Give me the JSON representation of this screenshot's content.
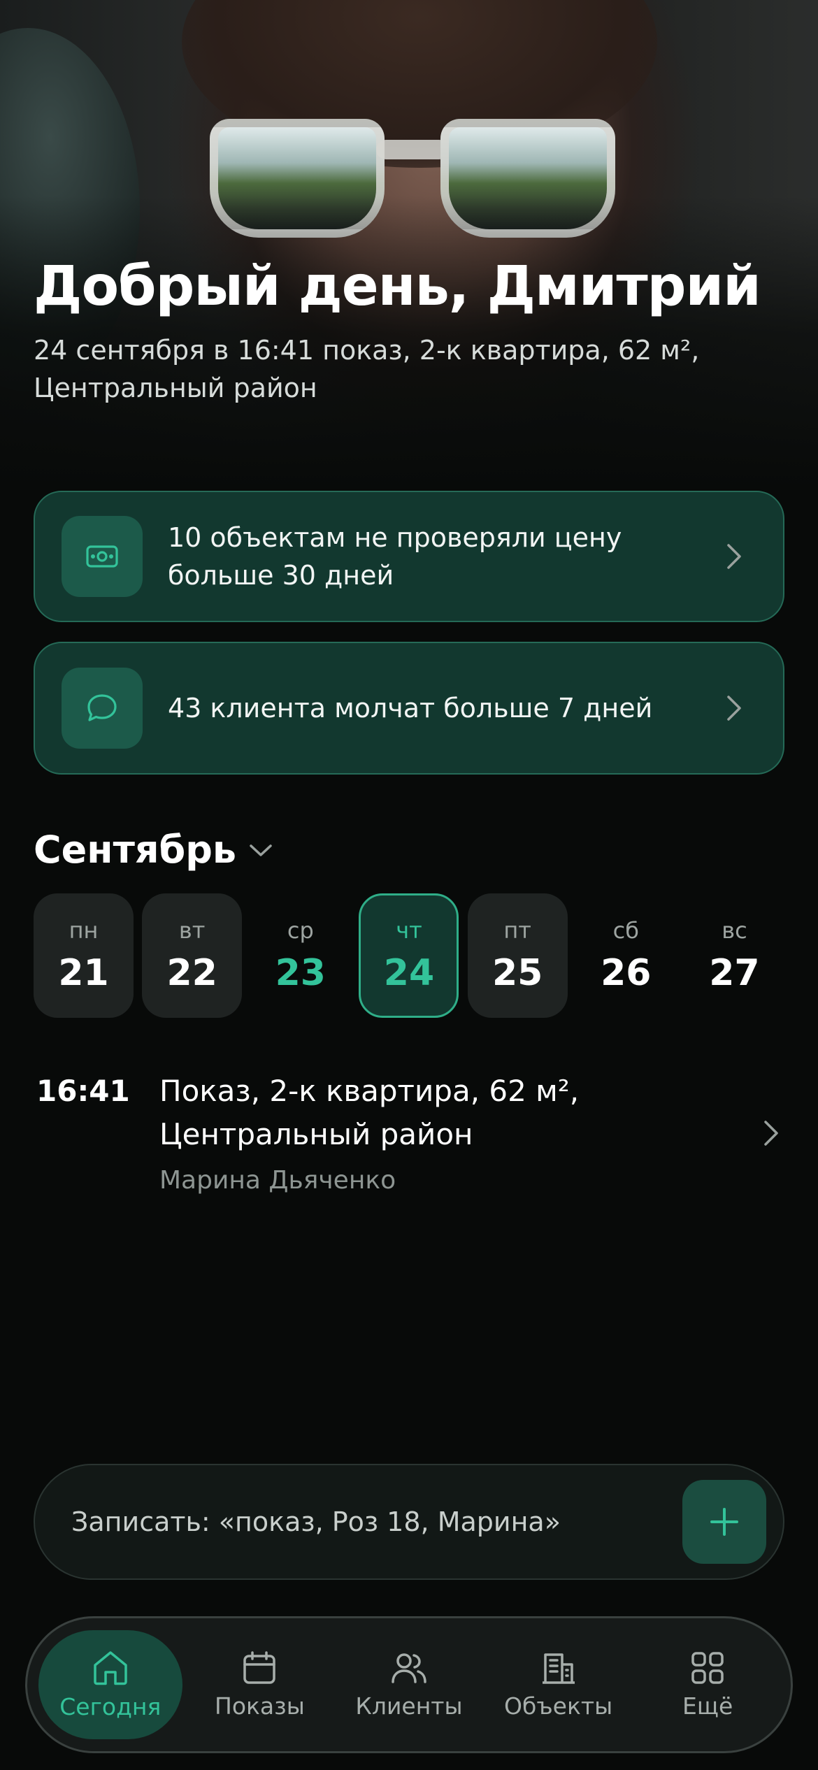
{
  "header": {
    "greeting": "Добрый день, Дмитрий",
    "subtitle": "24 сентября в 16:41 показ, 2-к квартира, 62 м², Центральный район"
  },
  "alerts": [
    {
      "icon": "money-icon",
      "text": "10 объектам не проверяли цену больше 30 дней"
    },
    {
      "icon": "chat-bubble-icon",
      "text": "43 клиента молчат больше 7 дней"
    }
  ],
  "calendar": {
    "month": "Сентябрь",
    "days": [
      {
        "dow": "пн",
        "num": "21"
      },
      {
        "dow": "вт",
        "num": "22"
      },
      {
        "dow": "ср",
        "num": "23"
      },
      {
        "dow": "чт",
        "num": "24"
      },
      {
        "dow": "пт",
        "num": "25"
      },
      {
        "dow": "сб",
        "num": "26"
      },
      {
        "dow": "вс",
        "num": "27"
      }
    ]
  },
  "event": {
    "time": "16:41",
    "title": "Показ, 2-к квартира, 62 м², Центральный район",
    "person": "Марина Дьяченко"
  },
  "quick_input": {
    "placeholder": "Записать: «показ, Роз 18, Марина»"
  },
  "tabbar": {
    "items": [
      {
        "label": "Сегодня",
        "icon": "home-icon",
        "active": true
      },
      {
        "label": "Показы",
        "icon": "calendar-icon"
      },
      {
        "label": "Клиенты",
        "icon": "people-icon"
      },
      {
        "label": "Объекты",
        "icon": "building-icon"
      },
      {
        "label": "Ещё",
        "icon": "grid-icon"
      }
    ]
  },
  "colors": {
    "accent": "#33c39a",
    "card_bg": "#12382f",
    "background": "#080a09"
  }
}
